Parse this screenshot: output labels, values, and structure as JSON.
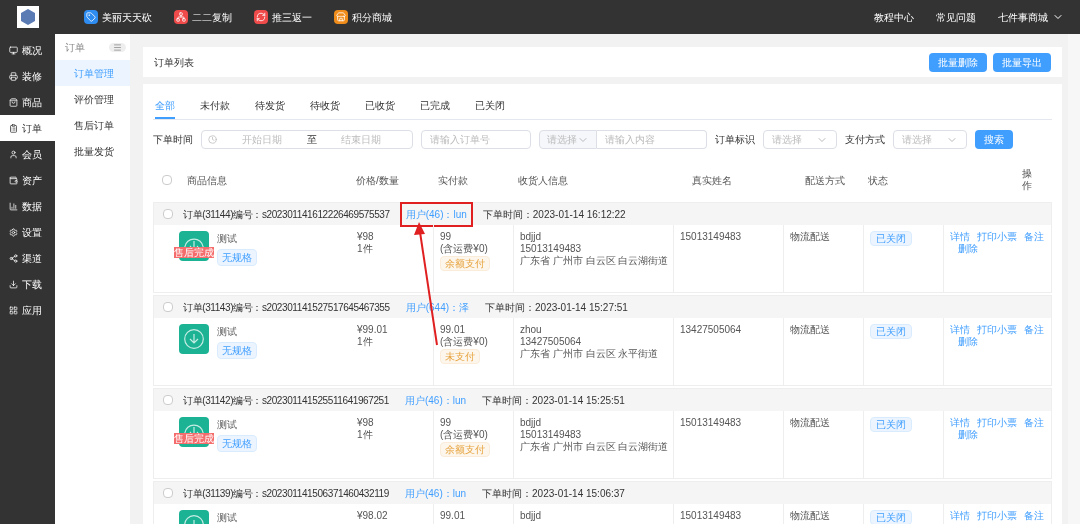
{
  "top_nav": {
    "items": [
      {
        "label": "美丽天天砍",
        "color": "#2f8cf0"
      },
      {
        "label": "二二复制",
        "color": "#f04b4b"
      },
      {
        "label": "推三返一",
        "color": "#f04b4b"
      },
      {
        "label": "积分商城",
        "color": "#f08c1a"
      }
    ],
    "links": [
      "教程中心",
      "常见问题"
    ],
    "shop": "七件事商城"
  },
  "sidebar": {
    "items": [
      {
        "label": "概况",
        "selected": false
      },
      {
        "label": "装修",
        "selected": false
      },
      {
        "label": "商品",
        "selected": false
      },
      {
        "label": "订单",
        "selected": true
      },
      {
        "label": "会员",
        "selected": false
      },
      {
        "label": "资产",
        "selected": false
      },
      {
        "label": "数据",
        "selected": false
      },
      {
        "label": "设置",
        "selected": false
      },
      {
        "label": "渠道",
        "selected": false
      },
      {
        "label": "下载",
        "selected": false
      },
      {
        "label": "应用",
        "selected": false
      }
    ]
  },
  "submenu": {
    "title": "订单",
    "items": [
      {
        "label": "订单管理",
        "selected": true
      },
      {
        "label": "评价管理",
        "selected": false
      },
      {
        "label": "售后订单",
        "selected": false
      },
      {
        "label": "批量发货",
        "selected": false
      }
    ]
  },
  "page_header": {
    "title": "订单列表",
    "buttons": [
      "批量删除",
      "批量导出"
    ]
  },
  "tabs": [
    {
      "label": "全部",
      "selected": true
    },
    {
      "label": "未付款",
      "selected": false
    },
    {
      "label": "待发货",
      "selected": false
    },
    {
      "label": "待收货",
      "selected": false
    },
    {
      "label": "已收货",
      "selected": false
    },
    {
      "label": "已完成",
      "selected": false
    },
    {
      "label": "已关闭",
      "selected": false
    }
  ],
  "filters": {
    "time_label": "下单时间",
    "start_placeholder": "开始日期",
    "separator": "至",
    "end_placeholder": "结束日期",
    "order_no_placeholder": "请输入订单号",
    "type_select_placeholder": "请选择",
    "content_placeholder": "请输入内容",
    "flag_label": "订单标识",
    "flag_placeholder": "请选择",
    "pay_label": "支付方式",
    "pay_placeholder": "请选择",
    "search_button": "搜索"
  },
  "table": {
    "select_all_checked": false,
    "columns": [
      "商品信息",
      "价格/数量",
      "实付款",
      "收货人信息",
      "真实姓名",
      "配送方式",
      "状态",
      "操作"
    ],
    "orders": [
      {
        "checked": false,
        "order": "订单(31144)编号：s202301141612226469575537",
        "user": "用户(46)：lun",
        "time": "下单时间：2023-01-14 16:12:22",
        "highlighted": true,
        "product": "测试",
        "spec": "无规格",
        "badge": "售后完成",
        "price_lines": [
          "¥98",
          "1件"
        ],
        "paid_lines": [
          "99",
          "(含运费¥0)"
        ],
        "pay_tag": "余额支付",
        "receiver_lines": [
          "bdjjd",
          "15013149483",
          "广东省 广州市 白云区 白云湖街道"
        ],
        "real_name": "15013149483",
        "shipping": "物流配送",
        "status": "已关闭",
        "actions": [
          "详情",
          "打印小票",
          "备注",
          "删除"
        ]
      },
      {
        "checked": false,
        "order": "订单(31143)编号：s202301141527517645467355",
        "user": "用户(644)：泽",
        "time": "下单时间：2023-01-14 15:27:51",
        "highlighted": false,
        "product": "测试",
        "spec": "无规格",
        "price_lines": [
          "¥99.01",
          "1件"
        ],
        "paid_lines": [
          "99.01",
          "(含运费¥0)"
        ],
        "pay_tag": "未支付",
        "receiver_lines": [
          "zhou",
          "13427505064",
          "广东省 广州市 白云区 永平街道"
        ],
        "real_name": "13427505064",
        "shipping": "物流配送",
        "status": "已关闭",
        "actions": [
          "详情",
          "打印小票",
          "备注",
          "删除"
        ]
      },
      {
        "checked": false,
        "order": "订单(31142)编号：s202301141525511641967251",
        "user": "用户(46)：lun",
        "time": "下单时间：2023-01-14 15:25:51",
        "highlighted": false,
        "product": "测试",
        "spec": "无规格",
        "badge": "售后完成",
        "price_lines": [
          "¥98",
          "1件"
        ],
        "paid_lines": [
          "99",
          "(含运费¥0)"
        ],
        "pay_tag": "余额支付",
        "receiver_lines": [
          "bdjjd",
          "15013149483",
          "广东省 广州市 白云区 白云湖街道"
        ],
        "real_name": "15013149483",
        "shipping": "物流配送",
        "status": "已关闭",
        "actions": [
          "详情",
          "打印小票",
          "备注",
          "删除"
        ]
      },
      {
        "checked": false,
        "order": "订单(31139)编号：s202301141506371460432119",
        "user": "用户(46)：lun",
        "time": "下单时间：2023-01-14 15:06:37",
        "highlighted": false,
        "product": "测试",
        "price_lines": [
          "¥98.02"
        ],
        "paid_lines": [
          "99.01"
        ],
        "receiver_lines": [
          "bdjjd"
        ],
        "real_name": "15013149483",
        "shipping": "物流配送",
        "status": "已关闭",
        "actions": [
          "详情",
          "打印小票",
          "备注"
        ]
      }
    ]
  }
}
